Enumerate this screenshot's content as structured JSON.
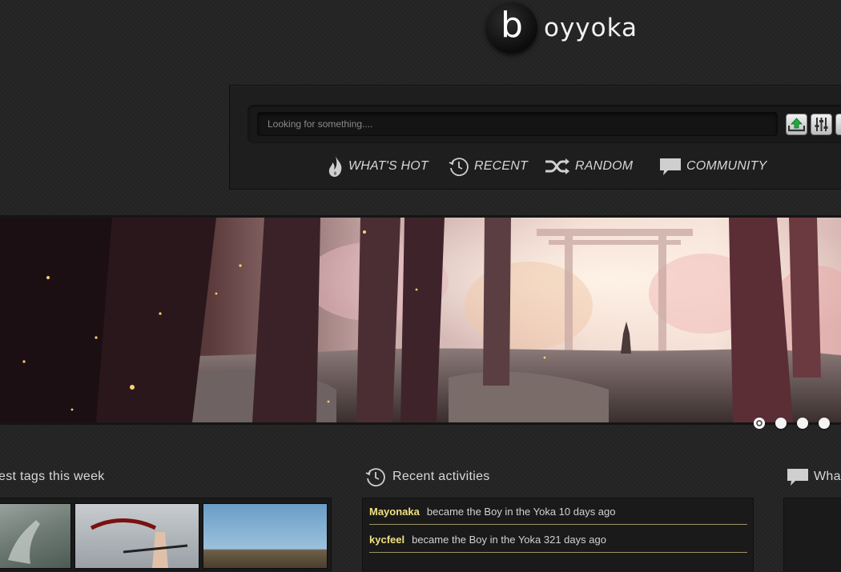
{
  "site": {
    "logo_letter": "b",
    "logo_name": "oyyoka"
  },
  "search": {
    "placeholder": "Looking for something....",
    "value": ""
  },
  "toolbar": {
    "upload_icon": "upload-icon",
    "settings_icon": "equalizer-icon"
  },
  "nav": {
    "items": [
      {
        "label": "WHAT'S HOT",
        "icon": "flame-icon"
      },
      {
        "label": "RECENT",
        "icon": "clock-icon"
      },
      {
        "label": "RANDOM",
        "icon": "shuffle-icon"
      },
      {
        "label": "COMMUNITY",
        "icon": "speech-bubble-icon"
      }
    ]
  },
  "banner": {
    "slide_count": 4,
    "active_slide": 1
  },
  "sections": {
    "tags": {
      "title": "est tags this week"
    },
    "activities": {
      "title": "Recent activities",
      "items": [
        {
          "user": "Mayonaka",
          "text": "became the Boy in the Yoka 10 days ago"
        },
        {
          "user": "kycfeel",
          "text": "became the Boy in the Yoka 321 days ago"
        }
      ]
    },
    "community": {
      "title": "Wha"
    }
  },
  "colors": {
    "background": "#242424",
    "username": "#f0e080",
    "row_rule": "#9c9466"
  }
}
